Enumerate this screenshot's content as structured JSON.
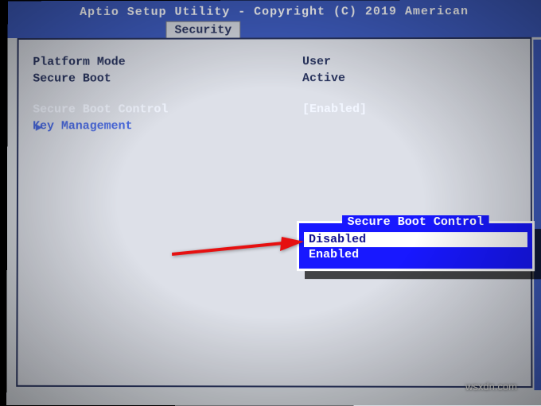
{
  "header": {
    "title": "Aptio Setup Utility - Copyright (C) 2019 American"
  },
  "tabs": {
    "active": "Security"
  },
  "fields": {
    "platform_mode": {
      "label": "Platform Mode",
      "value": "User"
    },
    "secure_boot": {
      "label": "Secure Boot",
      "value": "Active"
    },
    "secure_boot_control": {
      "label": "Secure Boot Control",
      "value": "[Enabled]"
    },
    "key_management": {
      "label": "Key Management"
    }
  },
  "popup": {
    "title": "Secure Boot Control",
    "options": [
      "Disabled",
      "Enabled"
    ],
    "selected_index": 0
  },
  "watermark": "wsxdn.com"
}
